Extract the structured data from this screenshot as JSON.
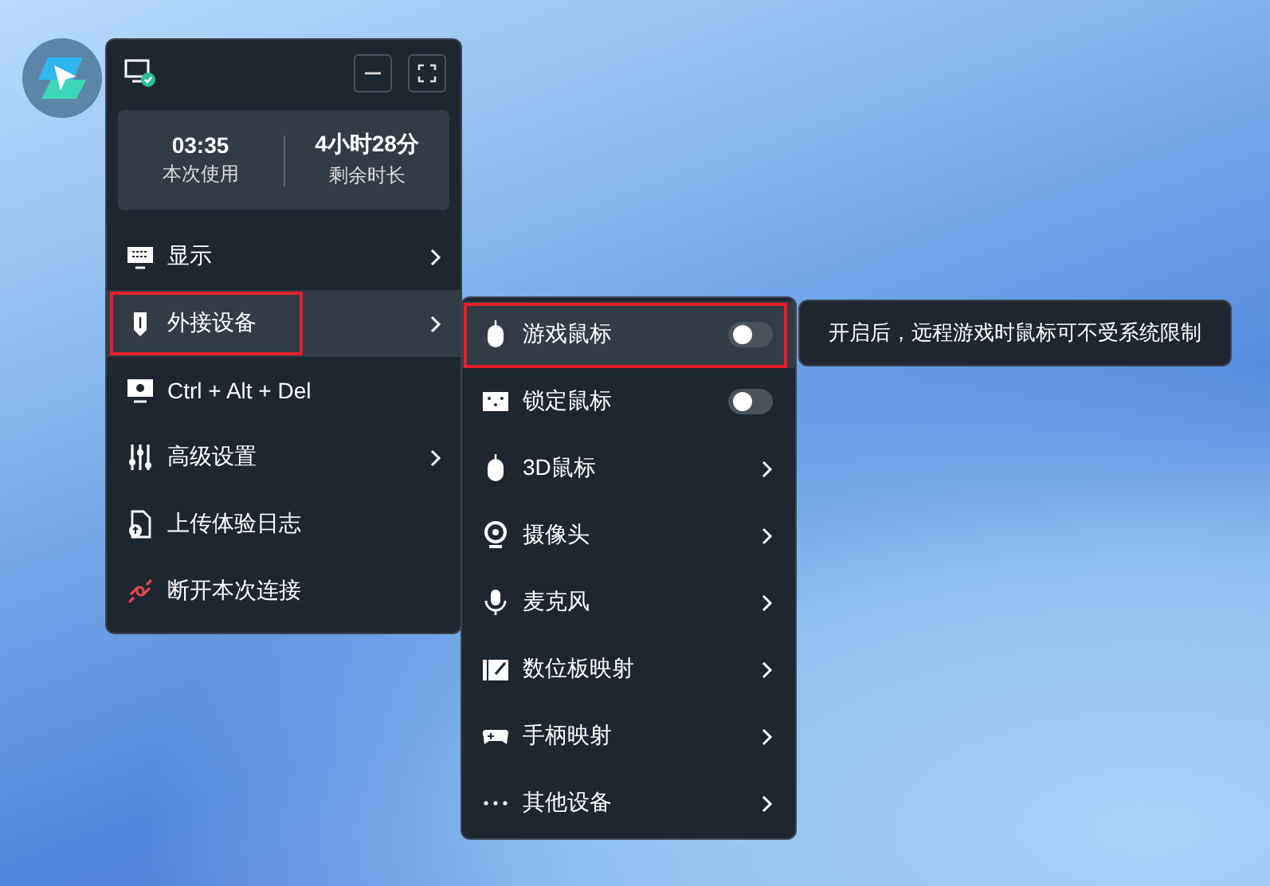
{
  "session": {
    "used_time": "03:35",
    "used_label": "本次使用",
    "remaining_time": "4小时28分",
    "remaining_label": "剩余时长"
  },
  "menu": [
    {
      "label": "显示",
      "kind": "submenu",
      "selected": false,
      "annotated": false
    },
    {
      "label": "外接设备",
      "kind": "submenu",
      "selected": true,
      "annotated": true
    },
    {
      "label": "Ctrl + Alt + Del",
      "kind": "action",
      "selected": false,
      "annotated": false
    },
    {
      "label": "高级设置",
      "kind": "submenu",
      "selected": false,
      "annotated": false
    },
    {
      "label": "上传体验日志",
      "kind": "action",
      "selected": false,
      "annotated": false
    },
    {
      "label": "断开本次连接",
      "kind": "action",
      "selected": false,
      "annotated": false
    }
  ],
  "submenu": [
    {
      "label": "游戏鼠标",
      "kind": "toggle",
      "on": false,
      "selected": true,
      "annotated": true
    },
    {
      "label": "锁定鼠标",
      "kind": "toggle",
      "on": false,
      "selected": false,
      "annotated": false
    },
    {
      "label": "3D鼠标",
      "kind": "submenu",
      "selected": false,
      "annotated": false
    },
    {
      "label": "摄像头",
      "kind": "submenu",
      "selected": false,
      "annotated": false
    },
    {
      "label": "麦克风",
      "kind": "submenu",
      "selected": false,
      "annotated": false
    },
    {
      "label": "数位板映射",
      "kind": "submenu",
      "selected": false,
      "annotated": false
    },
    {
      "label": "手柄映射",
      "kind": "submenu",
      "selected": false,
      "annotated": false
    },
    {
      "label": "其他设备",
      "kind": "submenu",
      "selected": false,
      "annotated": false
    }
  ],
  "tooltip": "开启后，远程游戏时鼠标可不受系统限制"
}
